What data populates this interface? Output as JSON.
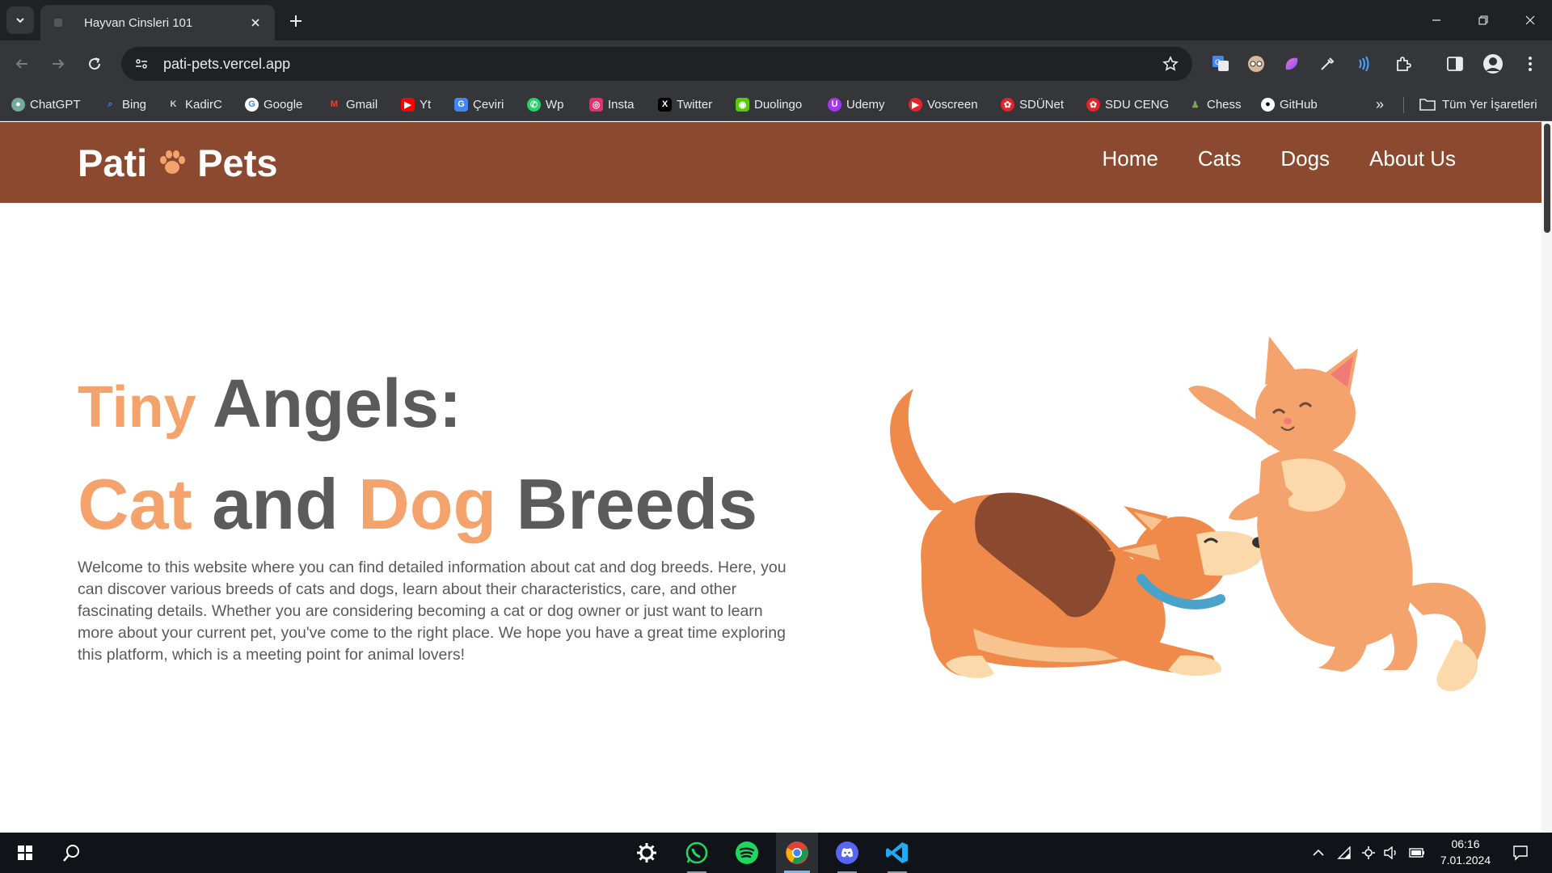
{
  "browser": {
    "tab_title": "Hayvan Cinsleri 101",
    "url": "pati-pets.vercel.app",
    "bookmarks": [
      {
        "label": "ChatGPT",
        "icon": "chatgpt-icon",
        "color": "#74aa9c"
      },
      {
        "label": "Bing",
        "icon": "bing-search-icon",
        "color": "#3b82f6"
      },
      {
        "label": "KadirC",
        "icon": "kadirc-icon",
        "color": "#9ca3af"
      },
      {
        "label": "Google",
        "icon": "google-icon",
        "color": "#4285f4"
      },
      {
        "label": "Gmail",
        "icon": "gmail-icon",
        "color": "#ea4335"
      },
      {
        "label": "Yt",
        "icon": "youtube-icon",
        "color": "#ff0000"
      },
      {
        "label": "Çeviri",
        "icon": "translate-icon",
        "color": "#4285f4"
      },
      {
        "label": "Wp",
        "icon": "whatsapp-icon",
        "color": "#25d366"
      },
      {
        "label": "Insta",
        "icon": "instagram-icon",
        "color": "#e1306c"
      },
      {
        "label": "Twitter",
        "icon": "x-icon",
        "color": "#000000"
      },
      {
        "label": "Duolingo",
        "icon": "duolingo-icon",
        "color": "#58cc02"
      },
      {
        "label": "Udemy",
        "icon": "udemy-icon",
        "color": "#a435f0"
      },
      {
        "label": "Voscreen",
        "icon": "voscreen-icon",
        "color": "#e5232a"
      },
      {
        "label": "SDÜNet",
        "icon": "sdunet-icon",
        "color": "#e5232a"
      },
      {
        "label": "SDU CENG",
        "icon": "sdu-ceng-icon",
        "color": "#e5232a"
      },
      {
        "label": "Chess",
        "icon": "chess-icon",
        "color": "#7fa650"
      },
      {
        "label": "GitHub",
        "icon": "github-icon",
        "color": "#ffffff"
      }
    ],
    "all_bookmarks_label": "Tüm Yer İşaretleri"
  },
  "site": {
    "logo_left": "Pati",
    "logo_right": "Pets",
    "nav": [
      "Home",
      "Cats",
      "Dogs",
      "About Us"
    ],
    "hero": {
      "line1_accent": "Tiny",
      "line1_rest": "Angels:",
      "line2_word1": "Cat",
      "line2_word2": "and",
      "line2_word3": "Dog",
      "line2_word4": "Breeds",
      "description": "Welcome to this website where you can find detailed information about cat and dog breeds. Here, you can discover various breeds of cats and dogs, learn about their characteristics, care, and other fascinating details. Whether you are considering becoming a cat or dog owner or just want to learn more about your current pet, you've come to the right place. We hope you have a great time exploring this platform, which is a meeting point for animal lovers!"
    },
    "colors": {
      "header": "#8b4a2f",
      "accent": "#f3a36b",
      "heading": "#5b5b5b"
    }
  },
  "taskbar": {
    "time": "06:16",
    "date": "7.01.2024"
  }
}
